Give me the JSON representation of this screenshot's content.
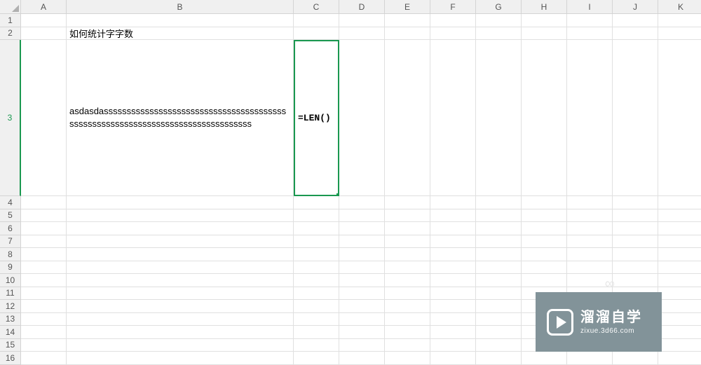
{
  "columns": [
    "A",
    "B",
    "C",
    "D",
    "E",
    "F",
    "G",
    "H",
    "I",
    "J",
    "K"
  ],
  "rows": [
    "1",
    "2",
    "3",
    "4",
    "5",
    "6",
    "7",
    "8",
    "9",
    "10",
    "11",
    "12",
    "13",
    "14",
    "15",
    "16"
  ],
  "activeRow": "3",
  "cells": {
    "B2": "如何统计字字数",
    "B3": "asdasdassssssssssssssssssssssssssssssssssssssssssssssssssssssssssssssssssssssssssssssss",
    "C3": "=LEN()"
  },
  "watermark": {
    "title": "溜溜自学",
    "url": "zixue.3d66.com"
  }
}
